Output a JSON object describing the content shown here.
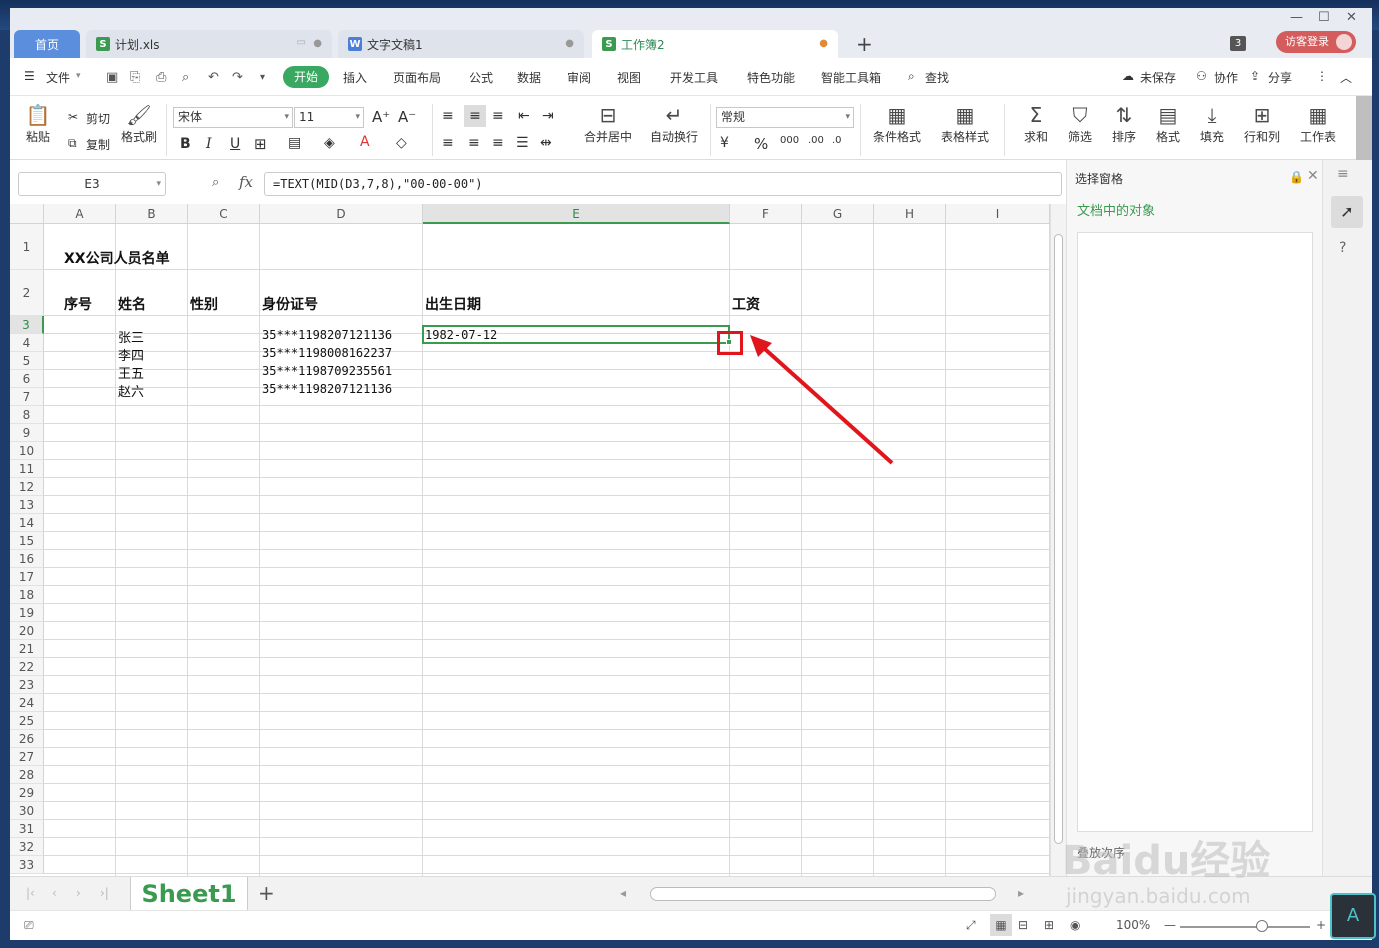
{
  "tabs": {
    "home": "首页",
    "docs": [
      {
        "name": "计划.xls",
        "icon": "S",
        "color": "#3a9a50"
      },
      {
        "name": "文字文稿1",
        "icon": "W",
        "color": "#4a7fd8"
      },
      {
        "name": "工作簿2",
        "icon": "S",
        "color": "#3a9a50"
      }
    ],
    "count": "3",
    "login": "访客登录"
  },
  "menu": {
    "file": "文件",
    "items": [
      "开始",
      "插入",
      "页面布局",
      "公式",
      "数据",
      "审阅",
      "视图",
      "开发工具",
      "特色功能",
      "智能工具箱"
    ],
    "search": "查找",
    "unsaved": "未保存",
    "collab": "协作",
    "share": "分享"
  },
  "ribbon": {
    "paste": "粘贴",
    "cut": "剪切",
    "copy": "复制",
    "format_painter": "格式刷",
    "font": "宋体",
    "size": "11",
    "merge": "合并居中",
    "wrap": "自动换行",
    "number_format": "常规",
    "cond_format": "条件格式",
    "table_style": "表格样式",
    "sum": "求和",
    "filter": "筛选",
    "sort": "排序",
    "format": "格式",
    "fill": "填充",
    "rowcol": "行和列",
    "sheet": "工作表"
  },
  "formula_bar": {
    "name_box": "E3",
    "fx": "fx",
    "formula": "=TEXT(MID(D3,7,8),\"00-00-00\")"
  },
  "grid": {
    "columns": [
      "A",
      "B",
      "C",
      "D",
      "E",
      "F",
      "G",
      "H",
      "I"
    ],
    "rows": [
      "1",
      "2",
      "3",
      "4",
      "5",
      "6",
      "7",
      "8",
      "9",
      "10",
      "11",
      "12",
      "13",
      "14",
      "15",
      "16",
      "17",
      "18",
      "19",
      "20",
      "21",
      "22",
      "23",
      "24",
      "25",
      "26",
      "27",
      "28",
      "29",
      "30",
      "31",
      "32",
      "33"
    ],
    "title": "XX公司人员名单",
    "headers": {
      "A": "序号",
      "B": "姓名",
      "C": "性别",
      "D": "身份证号",
      "E": "出生日期",
      "F": "工资"
    },
    "names": [
      "张三",
      "李四",
      "王五",
      "赵六"
    ],
    "ids": [
      "35***1198207121136",
      "35***1198008162237",
      "35***1198709235561",
      "35***1198207121136"
    ],
    "birth": "1982-07-12",
    "selected_cell": "E3"
  },
  "pane": {
    "title": "选择窗格",
    "subtitle": "文档中的对象",
    "footer": "叠放次序"
  },
  "sheets": {
    "active": "Sheet1"
  },
  "status": {
    "zoom": "100%"
  },
  "watermark": {
    "main": "Baidu经验",
    "url": "jingyan.baidu.com"
  },
  "colors": {
    "accent": "#3a9a50",
    "home_tab": "#5b8fde",
    "annotation": "#e0161c"
  }
}
